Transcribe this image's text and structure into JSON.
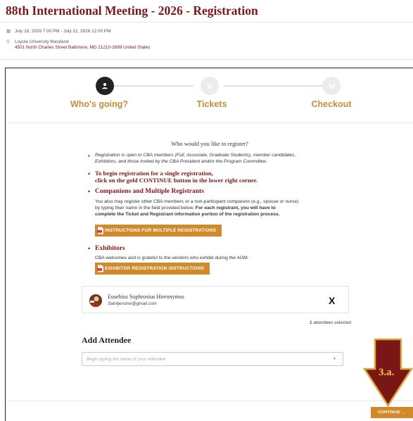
{
  "page": {
    "title": "88th International Meeting - 2026 - Registration"
  },
  "event": {
    "date_range": "July 18, 2026 7:00 PM - July 21, 2026 12:00 PM",
    "venue": "Loyola University Maryland",
    "address": "4501 North Charles Street Baltimore, MD 21210-2699 United States"
  },
  "steps": [
    {
      "label": "Who's going?",
      "icon": "user-icon",
      "state": "active"
    },
    {
      "label": "Tickets",
      "icon": "ticket-icon",
      "state": "inactive"
    },
    {
      "label": "Checkout",
      "icon": "cart-icon",
      "state": "inactive"
    }
  ],
  "form": {
    "question": "Who would you like to register?",
    "bullet1_line1": "Registration is open to CBA members (Full, Associate, Graduate Students), member candidates,",
    "bullet1_line2": "Exhibitors, and those invited by the CBA President and/or the Program Committee.",
    "bullet2_line1": "To begin registration for a single registration,",
    "bullet2_line2": "click on the gold CONTINUE button in the lower right corner.",
    "companions_heading": "Companions and Multiple Registrants",
    "companions_line1": "You also may register other CBA members or a non-participant companion (e.g., spouse or nurse)",
    "companions_line2_plain": "by typing their name in the field provided below. ",
    "companions_line2_bold": "For each registrant, you will have to",
    "companions_line3_bold": "complete the Ticket and Registrant information portion of the registration process.",
    "multi_button": "INSTRUCTIONS FOR MULTIPLE REGISTRATIONS",
    "exhibitors_heading": "Exhibitors",
    "exhibitors_text": "CBA welcomes and is grateful to the vendors who exhibit during the AGM.",
    "exhibitor_button": "EXHIBITOR REGISTRATION INSTRUCTIONS"
  },
  "attendee": {
    "name": "Eusebius Sophronius Hieronymus",
    "email": "Saintjerome@gmail.com",
    "remove_label": "X"
  },
  "selection": {
    "count": "1",
    "suffix": " attendees selected"
  },
  "add_attendee": {
    "title": "Add Attendee",
    "placeholder": "Begin typing the name of your Attendee"
  },
  "continue_label": "CONTINUE →",
  "annotation": {
    "label": "3.a."
  },
  "colors": {
    "brand": "#7a1818",
    "gold": "#d08a2a",
    "step_label": "#c98c3a",
    "arrow_fill": "#7a1616",
    "arrow_border": "#d8a93a"
  }
}
